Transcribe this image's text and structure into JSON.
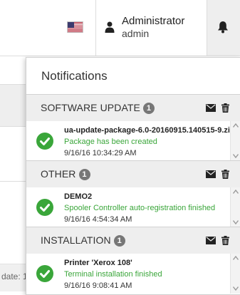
{
  "header": {
    "flag_icon": "us-flag-icon",
    "user_name": "Administrator",
    "user_role": "admin",
    "user_icon": "user-icon",
    "bell_icon": "bell-icon"
  },
  "background": {
    "partial_text": "date: 1"
  },
  "notifications": {
    "title": "Notifications",
    "sections": [
      {
        "label": "SOFTWARE UPDATE",
        "count": "1",
        "items": [
          {
            "title": "ua-update-package-6.0-20160915.140515-9.zip",
            "message": "Package has been created",
            "time": "9/16/16 10:34:29 AM"
          }
        ]
      },
      {
        "label": "OTHER",
        "count": "1",
        "items": [
          {
            "title": "DEMO2",
            "message": "Spooler Controller auto-registration finished",
            "time": "9/16/16 4:54:34 AM"
          }
        ]
      },
      {
        "label": "INSTALLATION",
        "count": "1",
        "items": [
          {
            "title": "Printer 'Xerox 108'",
            "message": "Terminal installation finished",
            "time": "9/16/16 9:08:41 AM"
          }
        ]
      }
    ]
  },
  "colors": {
    "success": "#3aa63a",
    "badge": "#777777",
    "section_bg": "#eeeeee"
  }
}
